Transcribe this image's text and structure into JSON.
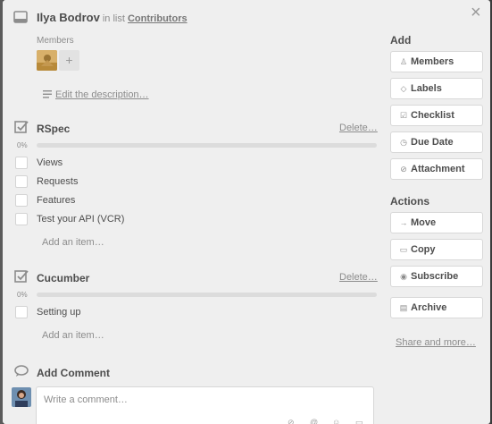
{
  "card": {
    "title": "Ilya Bodrov",
    "in_list_text": "in list",
    "list_name": "Contributors"
  },
  "members": {
    "label": "Members",
    "add_symbol": "+"
  },
  "description": {
    "edit_label": "Edit the description…"
  },
  "checklists": [
    {
      "title": "RSpec",
      "delete_label": "Delete…",
      "progress_label": "0%",
      "progress": 0,
      "items": [
        "Views",
        "Requests",
        "Features",
        "Test your API (VCR)"
      ],
      "add_item_label": "Add an item…"
    },
    {
      "title": "Cucumber",
      "delete_label": "Delete…",
      "progress_label": "0%",
      "progress": 0,
      "items": [
        "Setting up"
      ],
      "add_item_label": "Add an item…"
    }
  ],
  "comment": {
    "heading": "Add Comment",
    "placeholder": "Write a comment…"
  },
  "sidebar": {
    "add_heading": "Add",
    "add_buttons": [
      "Members",
      "Labels",
      "Checklist",
      "Due Date",
      "Attachment"
    ],
    "actions_heading": "Actions",
    "action_buttons": [
      "Move",
      "Copy",
      "Subscribe",
      "Archive"
    ],
    "share_label": "Share and more…"
  },
  "icons": {
    "close": "close-icon",
    "card": "card-icon",
    "description": "description-icon",
    "checklist": "checklist-icon",
    "comment": "comment-icon"
  }
}
